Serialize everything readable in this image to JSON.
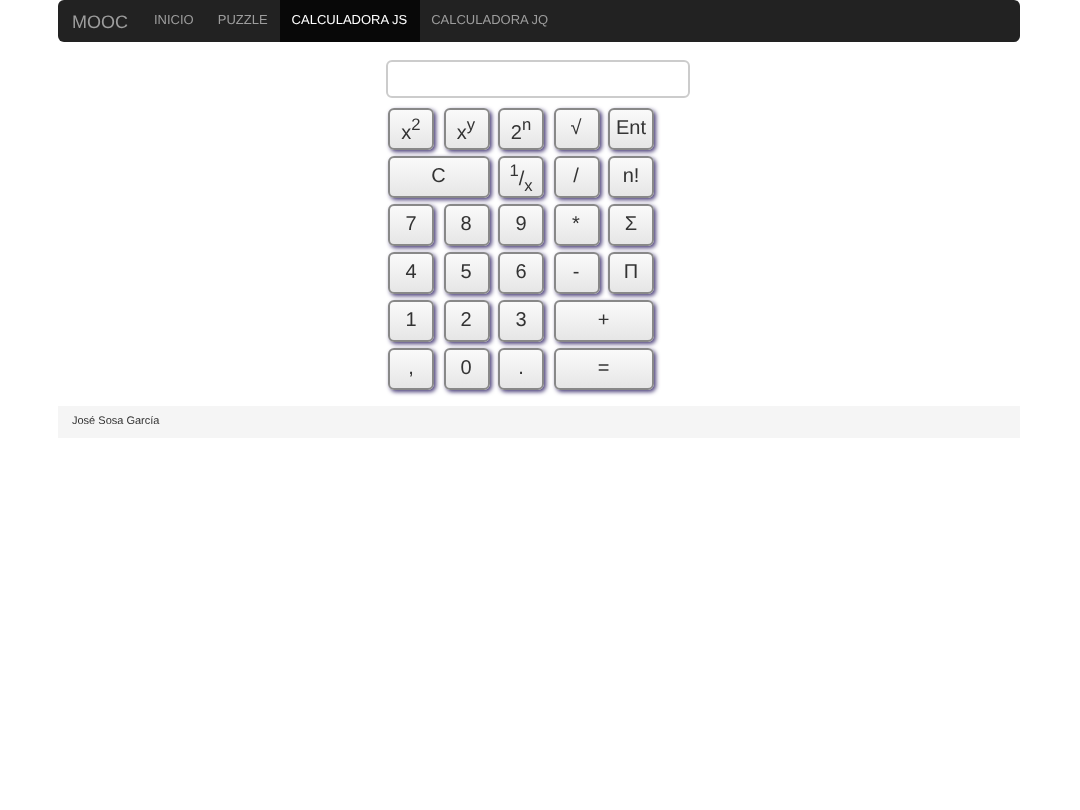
{
  "navbar": {
    "brand": "MOOC",
    "items": [
      {
        "label": "INICIO",
        "selected": false
      },
      {
        "label": "PUZZLE",
        "selected": false
      },
      {
        "label": "CALCULADORA JS",
        "selected": true
      },
      {
        "label": "CALCULADORA JQ",
        "selected": false
      }
    ]
  },
  "calculator": {
    "keys": [
      {
        "label": "x$^{2}$",
        "wide": false
      },
      {
        "label": "x$^{y}$",
        "wide": false
      },
      {
        "label": "2$^{n}$",
        "wide": false
      },
      {
        "label": "√",
        "wide": false
      },
      {
        "label": "Ent",
        "wide": false
      },
      {
        "label": "C",
        "wide": true
      },
      {
        "label": "$^{1}$/$_{x}$",
        "wide": false
      },
      {
        "label": "/",
        "wide": false
      },
      {
        "label": "n!",
        "wide": false
      },
      {
        "label": "7",
        "wide": false
      },
      {
        "label": "8",
        "wide": false
      },
      {
        "label": "9",
        "wide": false
      },
      {
        "label": "*",
        "wide": false
      },
      {
        "label": "Σ",
        "wide": false
      },
      {
        "label": "4",
        "wide": false
      },
      {
        "label": "5",
        "wide": false
      },
      {
        "label": "6",
        "wide": false
      },
      {
        "label": "-",
        "wide": false
      },
      {
        "label": "Π",
        "wide": false
      },
      {
        "label": "1",
        "wide": false
      },
      {
        "label": "2",
        "wide": false
      },
      {
        "label": "3",
        "wide": false
      },
      {
        "label": "+",
        "wide": true
      },
      {
        "label": ",",
        "wide": false
      },
      {
        "label": "0",
        "wide": false
      },
      {
        "label": ".",
        "wide": false
      },
      {
        "label": "=",
        "wide": true
      }
    ]
  },
  "footer": {
    "text": "José Sosa García"
  }
}
